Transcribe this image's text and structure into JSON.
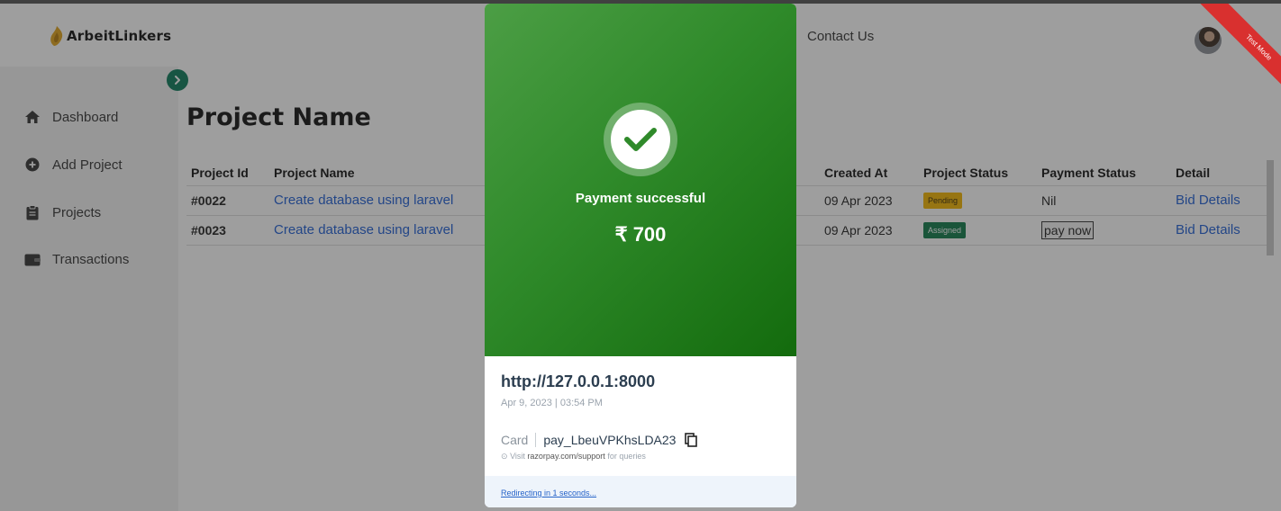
{
  "header": {
    "brand": "ArbeitLinkers",
    "nav_contact": "Contact Us"
  },
  "sidebar": {
    "items": [
      {
        "label": "Dashboard",
        "icon": "home-icon"
      },
      {
        "label": "Add Project",
        "icon": "plus-circle-icon"
      },
      {
        "label": "Projects",
        "icon": "clipboard-icon"
      },
      {
        "label": "Transactions",
        "icon": "wallet-icon"
      }
    ]
  },
  "main": {
    "title": "Project Name",
    "table": {
      "headers": {
        "id": "Project Id",
        "name": "Project Name",
        "created": "Created At",
        "project_status": "Project Status",
        "payment_status": "Payment Status",
        "detail": "Detail"
      },
      "rows": [
        {
          "id": "#0022",
          "name": "Create database using laravel",
          "created": "09 Apr 2023",
          "project_status": "Pending",
          "payment_status": "Nil",
          "detail": "Bid Details"
        },
        {
          "id": "#0023",
          "name": "Create database using laravel",
          "created": "09 Apr 2023",
          "project_status": "Assigned",
          "payment_status": "pay now",
          "detail": "Bid Details"
        }
      ]
    }
  },
  "ribbon": "Test Mode",
  "modal": {
    "message": "Payment successful",
    "amount": "₹ 700",
    "merchant": "http://127.0.0.1:8000",
    "date": "Apr 9, 2023 | 03:54 PM",
    "method": "Card",
    "payment_id": "pay_LbeuVPKhsLDA23",
    "support_prefix": "Visit",
    "support_link": "razorpay.com/support",
    "support_suffix": "for queries",
    "redirect": "Redirecting in 1 seconds..."
  },
  "colors": {
    "accent": "#0b7a5a",
    "success": "#2f8a2a",
    "pending": "#f2b400",
    "assigned": "#0f7a4a",
    "link": "#1f5fd6",
    "ribbon": "#d9302f"
  }
}
